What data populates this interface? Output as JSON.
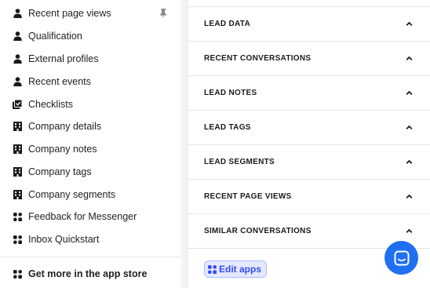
{
  "left_menu": {
    "items": [
      {
        "label": "Recent page views",
        "icon": "person-icon"
      },
      {
        "label": "Qualification",
        "icon": "person-icon"
      },
      {
        "label": "External profiles",
        "icon": "person-icon"
      },
      {
        "label": "Recent events",
        "icon": "person-icon"
      },
      {
        "label": "Checklists",
        "icon": "checklist-icon"
      },
      {
        "label": "Company details",
        "icon": "building-icon"
      },
      {
        "label": "Company notes",
        "icon": "building-icon"
      },
      {
        "label": "Company tags",
        "icon": "building-icon"
      },
      {
        "label": "Company segments",
        "icon": "building-icon"
      },
      {
        "label": "Feedback for Messenger",
        "icon": "apps-icon"
      },
      {
        "label": "Inbox Quickstart",
        "icon": "apps-icon"
      }
    ],
    "store_label": "Get more in the app store"
  },
  "right_sections": [
    {
      "title": "LEAD DATA"
    },
    {
      "title": "RECENT CONVERSATIONS"
    },
    {
      "title": "LEAD NOTES"
    },
    {
      "title": "LEAD TAGS"
    },
    {
      "title": "LEAD SEGMENTS"
    },
    {
      "title": "RECENT PAGE VIEWS"
    },
    {
      "title": "SIMILAR CONVERSATIONS"
    }
  ],
  "edit_apps_label": "Edit apps",
  "colors": {
    "accent": "#334bfa",
    "accent_bg": "#e4e9ff",
    "messenger": "#1f6ff2",
    "border": "#e5e5e5"
  }
}
